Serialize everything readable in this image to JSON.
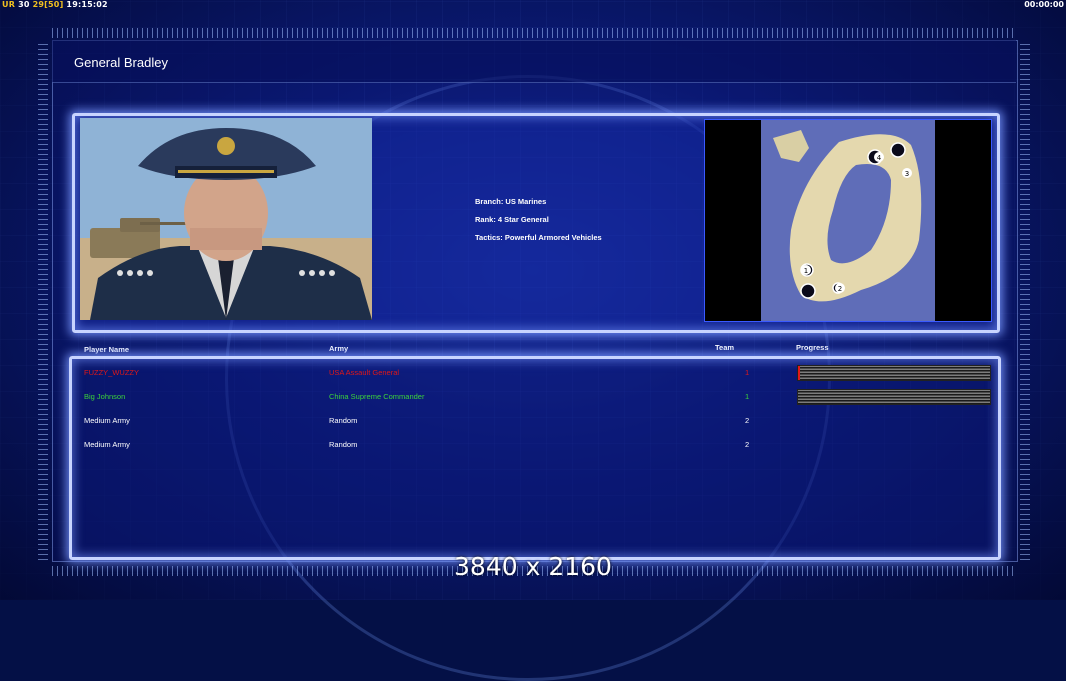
{
  "hud": {
    "ur_label": "UR",
    "fps": "30",
    "frame": "29",
    "bracket_value": "50",
    "clock": "19:15:02",
    "timer": "00:00:00"
  },
  "page_title": "General Bradley",
  "general_info": {
    "branch": "Branch: US Marines",
    "rank": "Rank: 4 Star General",
    "tactics": "Tactics: Powerful Armored Vehicles"
  },
  "map": {
    "start_positions": [
      "1",
      "2",
      "3",
      "4"
    ]
  },
  "table": {
    "headers": {
      "player_name": "Player Name",
      "army": "Army",
      "team": "Team",
      "progress": "Progress"
    },
    "rows": [
      {
        "name": "FUZZY_WUZZY",
        "army": "USA Assault General",
        "team": "1",
        "color": "#e01818",
        "progress": 0.01,
        "show_progress": true
      },
      {
        "name": "Big Johnson",
        "army": "China Supreme Commander",
        "team": "1",
        "color": "#3bd23b",
        "progress": 0.0,
        "show_progress": true
      },
      {
        "name": "Medium Army",
        "army": "Random",
        "team": "2",
        "color": "#ffffff",
        "show_progress": false
      },
      {
        "name": "Medium Army",
        "army": "Random",
        "team": "2",
        "color": "#ffffff",
        "show_progress": false
      }
    ]
  },
  "resolution_watermark": "3840 x 2160",
  "colors": {
    "panel_glow": "#c8d4ff",
    "background": "#0a1a7a",
    "hud_yellow": "#f0c020"
  }
}
